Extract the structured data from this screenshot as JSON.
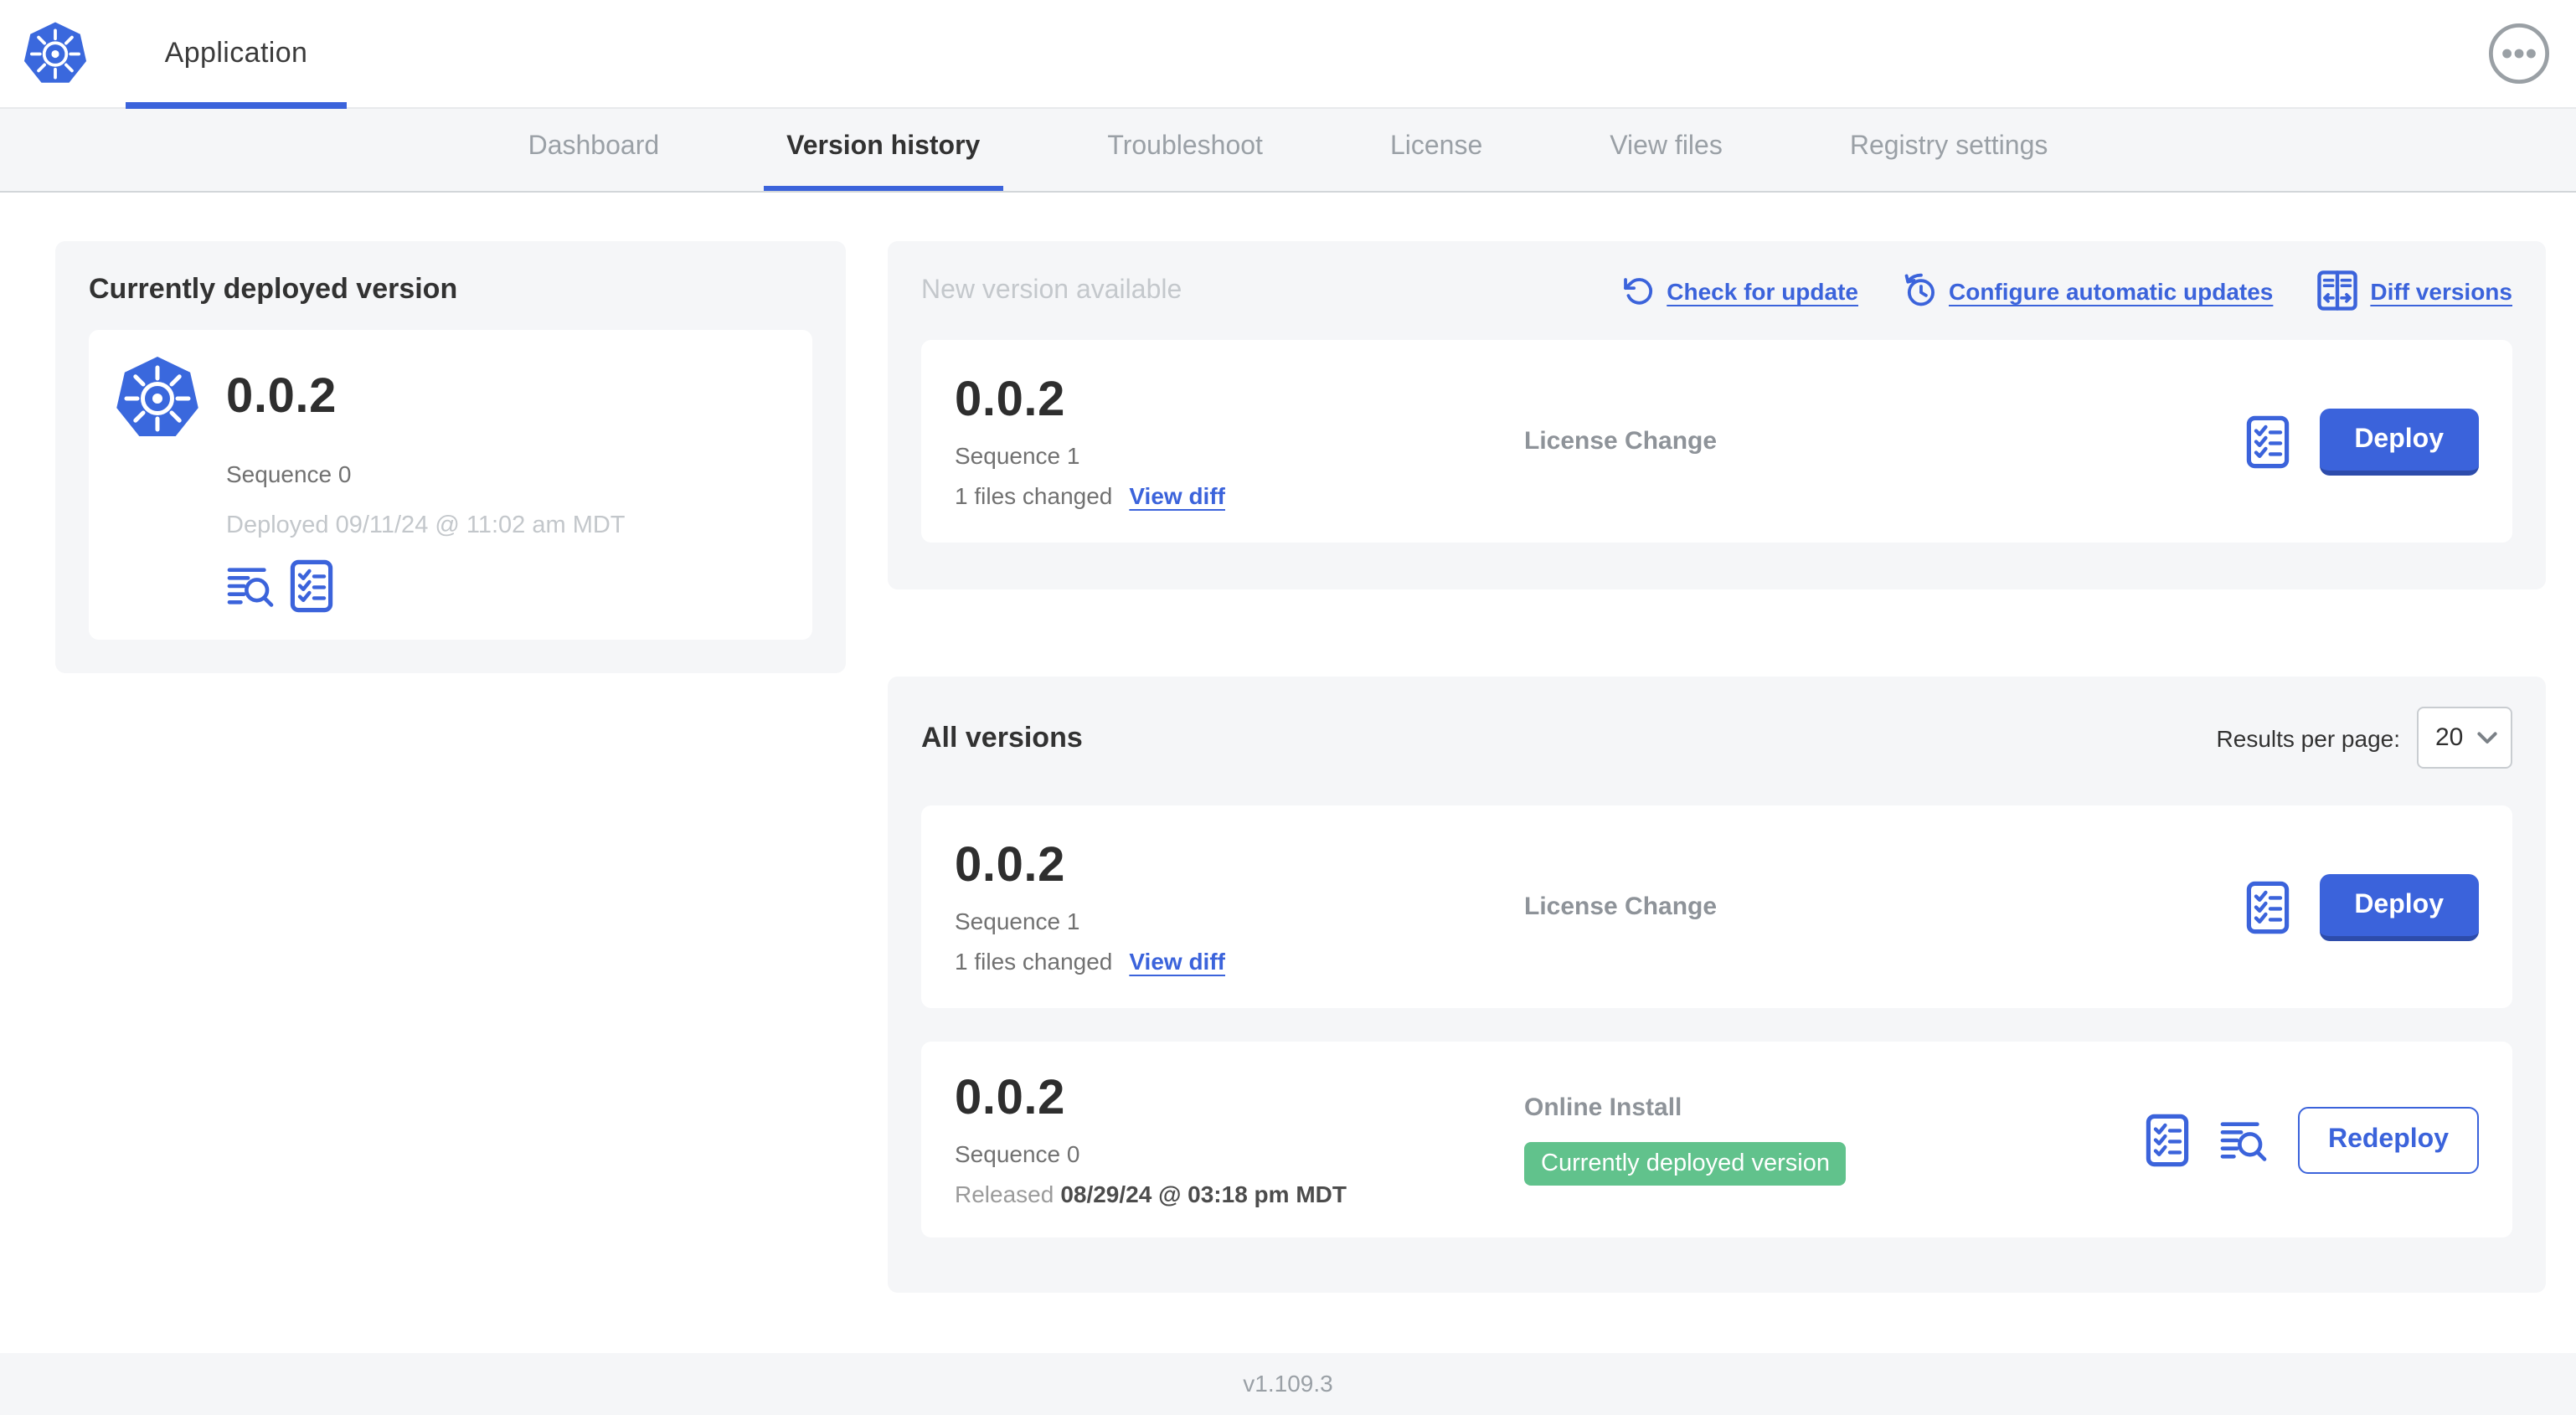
{
  "header": {
    "app_title": "Application"
  },
  "nav": {
    "tabs": [
      {
        "label": "Dashboard"
      },
      {
        "label": "Version history"
      },
      {
        "label": "Troubleshoot"
      },
      {
        "label": "License"
      },
      {
        "label": "View files"
      },
      {
        "label": "Registry settings"
      }
    ],
    "active_tab": "Version history"
  },
  "deployed_panel": {
    "title": "Currently deployed version",
    "version": "0.0.2",
    "sequence": "Sequence 0",
    "deployed_at": "Deployed 09/11/24 @ 11:02 am MDT"
  },
  "new_version_panel": {
    "title": "New version available",
    "check_for_update": "Check for update",
    "configure_updates": "Configure automatic updates",
    "diff_versions": "Diff versions",
    "card": {
      "version": "0.0.2",
      "sequence": "Sequence 1",
      "files_changed": "1 files changed",
      "view_diff": "View diff",
      "source": "License Change",
      "action": "Deploy"
    }
  },
  "all_versions_panel": {
    "title": "All versions",
    "results_per_page_label": "Results per page:",
    "results_per_page_value": "20",
    "rows": [
      {
        "version": "0.0.2",
        "sequence": "Sequence 1",
        "files_changed": "1 files changed",
        "view_diff": "View diff",
        "source": "License Change",
        "action": "Deploy"
      },
      {
        "version": "0.0.2",
        "sequence": "Sequence 0",
        "released_prefix": "Released",
        "released_date": "08/29/24 @ 03:18 pm MDT",
        "source": "Online Install",
        "badge": "Currently deployed version",
        "action": "Redeploy"
      }
    ]
  },
  "footer": {
    "app_version": "v1.109.3"
  },
  "colors": {
    "accent_blue": "#3b63db",
    "badge_green": "#61c28c",
    "panel_gray": "#f5f6f8"
  }
}
